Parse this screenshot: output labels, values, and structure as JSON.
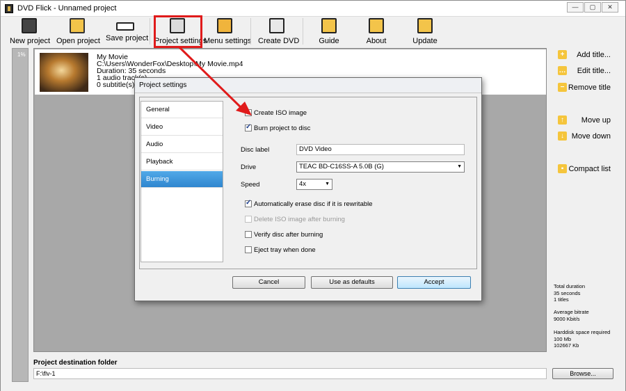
{
  "window": {
    "title": "DVD Flick - Unnamed project"
  },
  "toolbar": {
    "new_project": "New project",
    "open_project": "Open project",
    "save_project": "Save project",
    "project_settings": "Project settings",
    "menu_settings": "Menu settings",
    "create_dvd": "Create DVD",
    "guide": "Guide",
    "about": "About",
    "update": "Update"
  },
  "progress": {
    "percent_label": "1%"
  },
  "title_item": {
    "name": "My Movie",
    "path": "C:\\Users\\WonderFox\\Desktop\\My Movie.mp4",
    "duration": "Duration: 35 seconds",
    "audio": "1 audio track(s)",
    "subtitles": "0 subtitle(s)"
  },
  "side_panel": {
    "add_title": "Add title...",
    "edit_title": "Edit title...",
    "remove_title": "Remove title",
    "move_up": "Move up",
    "move_down": "Move down",
    "compact_list": "Compact list"
  },
  "stats": {
    "total_duration_label": "Total duration",
    "total_duration_value": "35 seconds",
    "titles_count": "1 titles",
    "avg_bitrate_label": "Average bitrate",
    "avg_bitrate_value": "9000 Kbit/s",
    "disk_space_label": "Harddisk space required",
    "disk_space_mb": "100 Mb",
    "disk_space_kb": "102667 Kb"
  },
  "destination": {
    "label": "Project destination folder",
    "value": "F:\\flv-1",
    "browse": "Browse..."
  },
  "dialog": {
    "title": "Project settings",
    "nav": [
      "General",
      "Video",
      "Audio",
      "Playback",
      "Burning"
    ],
    "active_nav": "Burning",
    "create_iso": {
      "label": "Create ISO image",
      "checked": false
    },
    "burn_to_disc": {
      "label": "Burn project to disc",
      "checked": true
    },
    "disc_label": {
      "label": "Disc label",
      "value": "DVD Video"
    },
    "drive": {
      "label": "Drive",
      "value": "TEAC BD-C16SS-A 5.0B (G)"
    },
    "speed": {
      "label": "Speed",
      "value": "4x"
    },
    "auto_erase": {
      "label": "Automatically erase disc if it is rewritable",
      "checked": true
    },
    "delete_iso": {
      "label": "Delete ISO image after burning",
      "checked": false,
      "disabled": true
    },
    "verify": {
      "label": "Verify disc after burning",
      "checked": false
    },
    "eject": {
      "label": "Eject tray when done",
      "checked": false
    },
    "buttons": {
      "cancel": "Cancel",
      "defaults": "Use as defaults",
      "accept": "Accept"
    }
  },
  "colors": {
    "highlight": "#e01b1b",
    "active_nav": "#2f86cf",
    "side_icon": "#f5c53c"
  }
}
